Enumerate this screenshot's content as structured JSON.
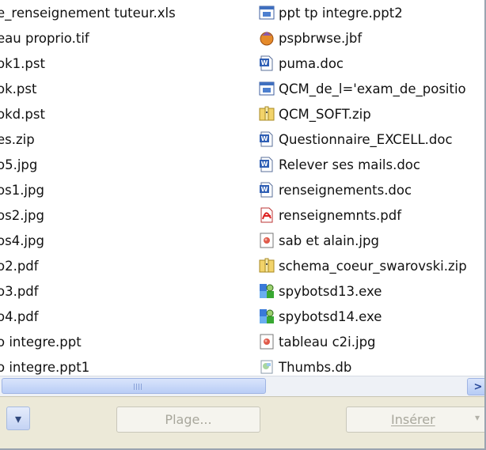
{
  "left_column": [
    {
      "label": "e_renseignement tuteur.xls",
      "icon": "none"
    },
    {
      "label": "eau proprio.tif",
      "icon": "none"
    },
    {
      "label": "ok1.pst",
      "icon": "none"
    },
    {
      "label": "ok.pst",
      "icon": "none"
    },
    {
      "label": "okd.pst",
      "icon": "none"
    },
    {
      "label": "es.zip",
      "icon": "none"
    },
    {
      "label": "o5.jpg",
      "icon": "none"
    },
    {
      "label": "os1.jpg",
      "icon": "none"
    },
    {
      "label": "os2.jpg",
      "icon": "none"
    },
    {
      "label": "os4.jpg",
      "icon": "none"
    },
    {
      "label": "o2.pdf",
      "icon": "none"
    },
    {
      "label": "o3.pdf",
      "icon": "none"
    },
    {
      "label": "o4.pdf",
      "icon": "none"
    },
    {
      "label": "o integre.ppt",
      "icon": "none"
    },
    {
      "label": "o integre.ppt1",
      "icon": "none"
    }
  ],
  "right_column": [
    {
      "label": "ppt tp integre.ppt2",
      "icon": "ppt-icon"
    },
    {
      "label": "pspbrwse.jbf",
      "icon": "jbf-icon"
    },
    {
      "label": "puma.doc",
      "icon": "word-doc-icon"
    },
    {
      "label": "QCM_de_l='exam_de_positio",
      "icon": "ppt-icon"
    },
    {
      "label": "QCM_SOFT.zip",
      "icon": "zip-icon"
    },
    {
      "label": "Questionnaire_EXCELL.doc",
      "icon": "word-doc-icon"
    },
    {
      "label": "Relever ses mails.doc",
      "icon": "word-doc-icon"
    },
    {
      "label": "renseignements.doc",
      "icon": "word-doc-icon"
    },
    {
      "label": "renseignemnts.pdf",
      "icon": "pdf-icon"
    },
    {
      "label": "sab et alain.jpg",
      "icon": "jpg-icon"
    },
    {
      "label": "schema_coeur_swarovski.zip",
      "icon": "zip-icon"
    },
    {
      "label": "spybotsd13.exe",
      "icon": "installer-icon"
    },
    {
      "label": "spybotsd14.exe",
      "icon": "installer-icon"
    },
    {
      "label": "tableau c2i.jpg",
      "icon": "jpg-icon"
    },
    {
      "label": "Thumbs.db",
      "icon": "db-icon"
    }
  ],
  "scrollbar": {
    "right_arrow": ">",
    "thumb_grip": "III"
  },
  "bottom": {
    "dropdown_glyph": "▾",
    "plage_label": "Plage...",
    "inserer_label": "Insérer",
    "inserer_arrow": "▾"
  }
}
